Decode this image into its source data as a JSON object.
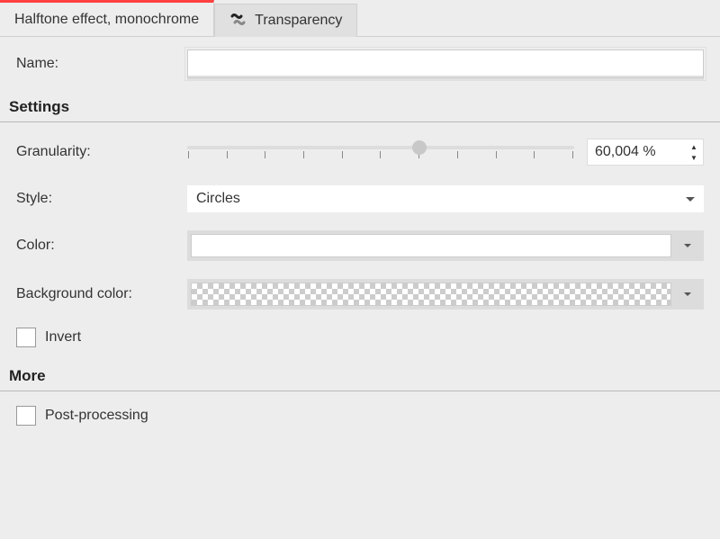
{
  "tabs": {
    "active": {
      "label": "Halftone effect, monochrome"
    },
    "inactive": {
      "label": "Transparency"
    }
  },
  "fields": {
    "name_label": "Name:",
    "name_value": ""
  },
  "sections": {
    "settings": "Settings",
    "more": "More"
  },
  "settings": {
    "granularity_label": "Granularity:",
    "granularity_value": "60,004 %",
    "granularity_percent": 60.004,
    "style_label": "Style:",
    "style_value": "Circles",
    "color_label": "Color:",
    "color_value": "#ffffff",
    "bgcolor_label": "Background color:",
    "bgcolor_value": "transparent",
    "invert_label": "Invert",
    "invert_checked": false
  },
  "more": {
    "postprocessing_label": "Post-processing",
    "postprocessing_checked": false
  }
}
